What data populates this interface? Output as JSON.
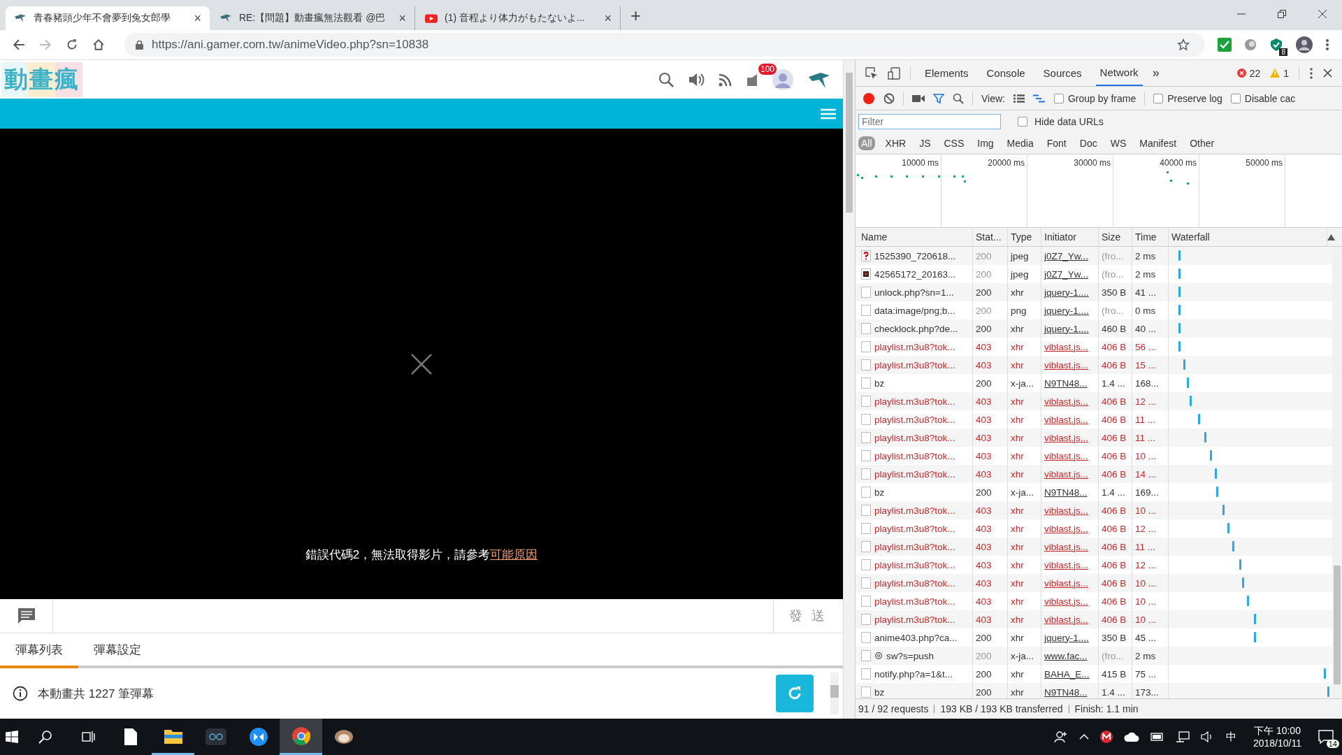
{
  "browser": {
    "tabs": [
      {
        "title": "青春豬頭少年不會夢到兔女郎學",
        "selected": true,
        "close": "×"
      },
      {
        "title": "RE:【問題】動畫瘋無法觀看 @巴",
        "selected": false,
        "close": "×"
      },
      {
        "title": "(1) 音程より体力がもたないよ...",
        "selected": false,
        "close": "×"
      }
    ],
    "new_tab": "+",
    "url": "https://ani.gamer.com.tw/animeVideo.php?sn=10838",
    "extension_badge": "8"
  },
  "site": {
    "logo": "動畫瘋",
    "notification_count": "100",
    "player": {
      "error_text": "錯誤代碼2，無法取得影片，請參考",
      "error_link": "可能原因"
    },
    "send_button": "發 送",
    "danmaku_tabs": [
      {
        "label": "彈幕列表",
        "selected": true
      },
      {
        "label": "彈幕設定",
        "selected": false
      }
    ],
    "danmaku_info": "本動畫共 1227 筆彈幕"
  },
  "devtools": {
    "tabs": [
      {
        "label": "Elements",
        "selected": false
      },
      {
        "label": "Console",
        "selected": false
      },
      {
        "label": "Sources",
        "selected": false
      },
      {
        "label": "Network",
        "selected": true
      }
    ],
    "more": "»",
    "errors": "22",
    "warnings": "1",
    "view_label": "View:",
    "options": [
      {
        "label": "Group by frame",
        "checked": false
      },
      {
        "label": "Preserve log",
        "checked": false
      },
      {
        "label": "Disable cac",
        "checked": false
      }
    ],
    "filter": {
      "placeholder": "Filter"
    },
    "hide_data_urls": {
      "label": "Hide data URLs",
      "checked": false
    },
    "type_filters": [
      {
        "label": "All",
        "selected": true
      },
      {
        "label": "XHR",
        "selected": false
      },
      {
        "label": "JS",
        "selected": false
      },
      {
        "label": "CSS",
        "selected": false
      },
      {
        "label": "Img",
        "selected": false
      },
      {
        "label": "Media",
        "selected": false
      },
      {
        "label": "Font",
        "selected": false
      },
      {
        "label": "Doc",
        "selected": false
      },
      {
        "label": "WS",
        "selected": false
      },
      {
        "label": "Manifest",
        "selected": false
      },
      {
        "label": "Other",
        "selected": false
      }
    ],
    "timeline_ticks": [
      "10000 ms",
      "20000 ms",
      "30000 ms",
      "40000 ms",
      "50000 ms"
    ],
    "columns": [
      "Name",
      "Stat...",
      "Type",
      "Initiator",
      "Size",
      "Time",
      "Waterfall"
    ],
    "rows": [
      {
        "kind": "missing",
        "name": "1525390_720618...",
        "status": "200",
        "type": "jpeg",
        "initiator": "j0Z7_Yw...",
        "size": "(fro...",
        "time": "2 ms",
        "failed": false,
        "cached": true
      },
      {
        "kind": "image",
        "name": "42565172_20163...",
        "status": "200",
        "type": "jpeg",
        "initiator": "j0Z7_Yw...",
        "size": "(fro...",
        "time": "2 ms",
        "failed": false,
        "cached": true
      },
      {
        "kind": "file",
        "name": "unlock.php?sn=1...",
        "status": "200",
        "type": "xhr",
        "initiator": "jquery-1....",
        "size": "350 B",
        "time": "41 ...",
        "failed": false,
        "cached": false
      },
      {
        "kind": "file",
        "name": "data:image/png;b...",
        "status": "200",
        "type": "png",
        "initiator": "jquery-1....",
        "size": "(fro...",
        "time": "0 ms",
        "failed": false,
        "cached": true
      },
      {
        "kind": "file",
        "name": "checklock.php?de...",
        "status": "200",
        "type": "xhr",
        "initiator": "jquery-1....",
        "size": "460 B",
        "time": "40 ...",
        "failed": false,
        "cached": false
      },
      {
        "kind": "file",
        "name": "playlist.m3u8?tok...",
        "status": "403",
        "type": "xhr",
        "initiator": "viblast.js...",
        "size": "406 B",
        "time": "56 ...",
        "failed": true,
        "cached": false
      },
      {
        "kind": "file",
        "name": "playlist.m3u8?tok...",
        "status": "403",
        "type": "xhr",
        "initiator": "viblast.js...",
        "size": "406 B",
        "time": "15 ...",
        "failed": true,
        "cached": false
      },
      {
        "kind": "file",
        "name": "bz",
        "status": "200",
        "type": "x-ja...",
        "initiator": "N9TN48...",
        "size": "1.4 ...",
        "time": "168...",
        "failed": false,
        "cached": false
      },
      {
        "kind": "file",
        "name": "playlist.m3u8?tok...",
        "status": "403",
        "type": "xhr",
        "initiator": "viblast.js...",
        "size": "406 B",
        "time": "12 ...",
        "failed": true,
        "cached": false
      },
      {
        "kind": "file",
        "name": "playlist.m3u8?tok...",
        "status": "403",
        "type": "xhr",
        "initiator": "viblast.js...",
        "size": "406 B",
        "time": "11 ...",
        "failed": true,
        "cached": false
      },
      {
        "kind": "file",
        "name": "playlist.m3u8?tok...",
        "status": "403",
        "type": "xhr",
        "initiator": "viblast.js...",
        "size": "406 B",
        "time": "11 ...",
        "failed": true,
        "cached": false
      },
      {
        "kind": "file",
        "name": "playlist.m3u8?tok...",
        "status": "403",
        "type": "xhr",
        "initiator": "viblast.js...",
        "size": "406 B",
        "time": "10 ...",
        "failed": true,
        "cached": false
      },
      {
        "kind": "file",
        "name": "playlist.m3u8?tok...",
        "status": "403",
        "type": "xhr",
        "initiator": "viblast.js...",
        "size": "406 B",
        "time": "14 ...",
        "failed": true,
        "cached": false
      },
      {
        "kind": "file",
        "name": "bz",
        "status": "200",
        "type": "x-ja...",
        "initiator": "N9TN48...",
        "size": "1.4 ...",
        "time": "169...",
        "failed": false,
        "cached": false
      },
      {
        "kind": "file",
        "name": "playlist.m3u8?tok...",
        "status": "403",
        "type": "xhr",
        "initiator": "viblast.js...",
        "size": "406 B",
        "time": "10 ...",
        "failed": true,
        "cached": false
      },
      {
        "kind": "file",
        "name": "playlist.m3u8?tok...",
        "status": "403",
        "type": "xhr",
        "initiator": "viblast.js...",
        "size": "406 B",
        "time": "12 ...",
        "failed": true,
        "cached": false
      },
      {
        "kind": "file",
        "name": "playlist.m3u8?tok...",
        "status": "403",
        "type": "xhr",
        "initiator": "viblast.js...",
        "size": "406 B",
        "time": "11 ...",
        "failed": true,
        "cached": false
      },
      {
        "kind": "file",
        "name": "playlist.m3u8?tok...",
        "status": "403",
        "type": "xhr",
        "initiator": "viblast.js...",
        "size": "406 B",
        "time": "12 ...",
        "failed": true,
        "cached": false
      },
      {
        "kind": "file",
        "name": "playlist.m3u8?tok...",
        "status": "403",
        "type": "xhr",
        "initiator": "viblast.js...",
        "size": "406 B",
        "time": "10 ...",
        "failed": true,
        "cached": false
      },
      {
        "kind": "file",
        "name": "playlist.m3u8?tok...",
        "status": "403",
        "type": "xhr",
        "initiator": "viblast.js...",
        "size": "406 B",
        "time": "10 ...",
        "failed": true,
        "cached": false
      },
      {
        "kind": "file",
        "name": "playlist.m3u8?tok...",
        "status": "403",
        "type": "xhr",
        "initiator": "viblast.js...",
        "size": "406 B",
        "time": "10 ...",
        "failed": true,
        "cached": false
      },
      {
        "kind": "file",
        "name": "anime403.php?ca...",
        "status": "200",
        "type": "xhr",
        "initiator": "jquery-1....",
        "size": "350 B",
        "time": "45 ...",
        "failed": false,
        "cached": false
      },
      {
        "kind": "worker",
        "name": "sw?s=push",
        "status": "200",
        "type": "x-ja...",
        "initiator": "www.fac...",
        "size": "(fro...",
        "time": "2 ms",
        "failed": false,
        "cached": true
      },
      {
        "kind": "file",
        "name": "notify.php?a=1&t...",
        "status": "200",
        "type": "xhr",
        "initiator": "BAHA_E...",
        "size": "415 B",
        "time": "75 ...",
        "failed": false,
        "cached": false
      },
      {
        "kind": "file",
        "name": "bz",
        "status": "200",
        "type": "xhr",
        "initiator": "N9TN48...",
        "size": "1.4 ...",
        "time": "173...",
        "failed": false,
        "cached": false
      }
    ],
    "summary": [
      "91 / 92 requests",
      "193 KB / 193 KB transferred",
      "Finish: 1.1 min"
    ]
  },
  "taskbar": {
    "apps": [
      {
        "active": false
      },
      {
        "active": false
      },
      {
        "active": false
      },
      {
        "active": true
      },
      {
        "active": false
      },
      {
        "active": false
      },
      {
        "active": true
      },
      {
        "active": false
      }
    ],
    "ime": "中",
    "time": "下午 10:00",
    "date": "2018/10/11",
    "notifications": "14"
  }
}
